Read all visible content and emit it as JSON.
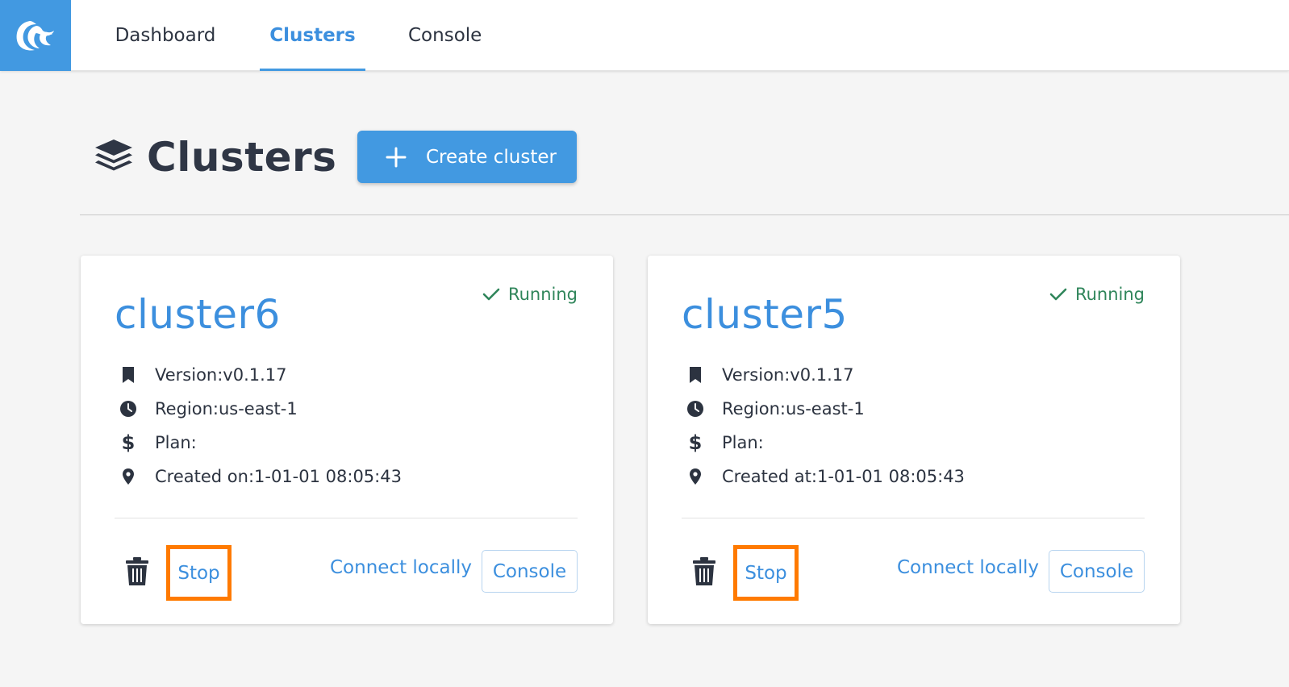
{
  "nav": {
    "items": [
      {
        "label": "Dashboard",
        "active": false
      },
      {
        "label": "Clusters",
        "active": true
      },
      {
        "label": "Console",
        "active": false
      }
    ]
  },
  "page": {
    "title": "Clusters",
    "create_button": "Create cluster"
  },
  "clusters": [
    {
      "name": "cluster6",
      "status": "Running",
      "version": "Version:v0.1.17",
      "region": "Region:us-east-1",
      "plan": "Plan:",
      "created": "Created on:1-01-01 08:05:43",
      "stop_label": "Stop",
      "connect_label": "Connect locally",
      "console_label": "Console"
    },
    {
      "name": "cluster5",
      "status": "Running",
      "version": "Version:v0.1.17",
      "region": "Region:us-east-1",
      "plan": "Plan:",
      "created": "Created at:1-01-01 08:05:43",
      "stop_label": "Stop",
      "connect_label": "Connect locally",
      "console_label": "Console"
    }
  ],
  "colors": {
    "accent": "#4299e1",
    "link": "#3c8fde",
    "status_running": "#2f855a",
    "highlight": "#ff7a00"
  },
  "icons": [
    "wave-logo-icon",
    "layers-icon",
    "plus-icon",
    "check-icon",
    "bookmark-icon",
    "clock-icon",
    "dollar-icon",
    "map-pin-icon",
    "trash-icon"
  ]
}
